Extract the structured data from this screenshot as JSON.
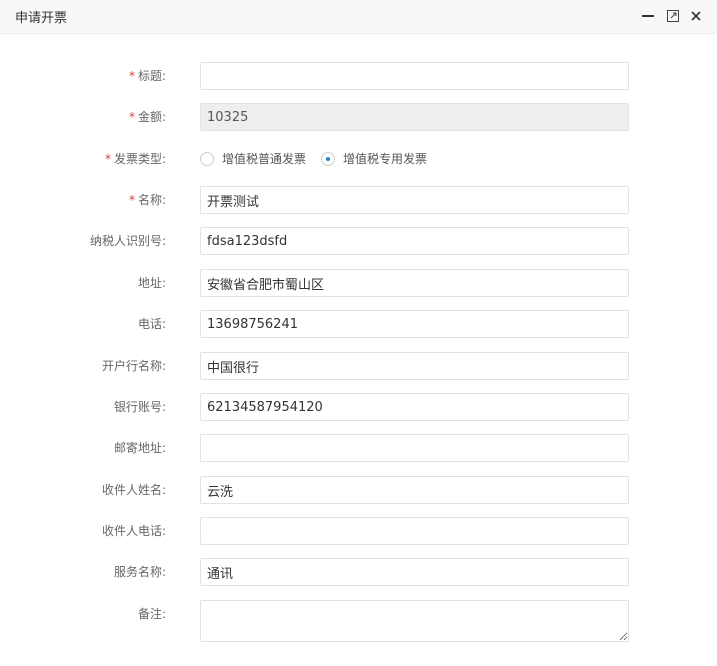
{
  "dialog": {
    "title": "申请开票"
  },
  "form": {
    "title": {
      "label": "标题:",
      "required": true,
      "value": ""
    },
    "amount": {
      "label": "金额:",
      "required": true,
      "value": "10325"
    },
    "invoice_type": {
      "label": "发票类型:",
      "required": true,
      "options": [
        "增值税普通发票",
        "增值税专用发票"
      ],
      "selected": "增值税专用发票"
    },
    "name": {
      "label": "名称:",
      "required": true,
      "value": "开票测试"
    },
    "tax_id": {
      "label": "纳税人识别号:",
      "value": "fdsa123dsfd"
    },
    "address": {
      "label": "地址:",
      "value": "安徽省合肥市蜀山区"
    },
    "phone": {
      "label": "电话:",
      "value": "13698756241"
    },
    "bank_name": {
      "label": "开户行名称:",
      "value": "中国很行"
    },
    "bank_account": {
      "label": "银行账号:",
      "value": "62134587954120"
    },
    "mail_address": {
      "label": "邮寄地址:",
      "value": ""
    },
    "recipient_name": {
      "label": "收件人姓名:",
      "value": "云洗"
    },
    "recipient_phone": {
      "label": "收件人电话:",
      "value": ""
    },
    "service_name": {
      "label": "服务名称:",
      "value": "通讯"
    },
    "remark": {
      "label": "备注:",
      "value": ""
    }
  },
  "required_mark": "*",
  "icons": {
    "minimize": "minimize-icon",
    "maximize": "maximize-icon",
    "close": "close-icon"
  },
  "colors": {
    "required": "#e4393c",
    "radio_dot": "#1e88c7",
    "disabled_bg": "#eeeeee"
  }
}
